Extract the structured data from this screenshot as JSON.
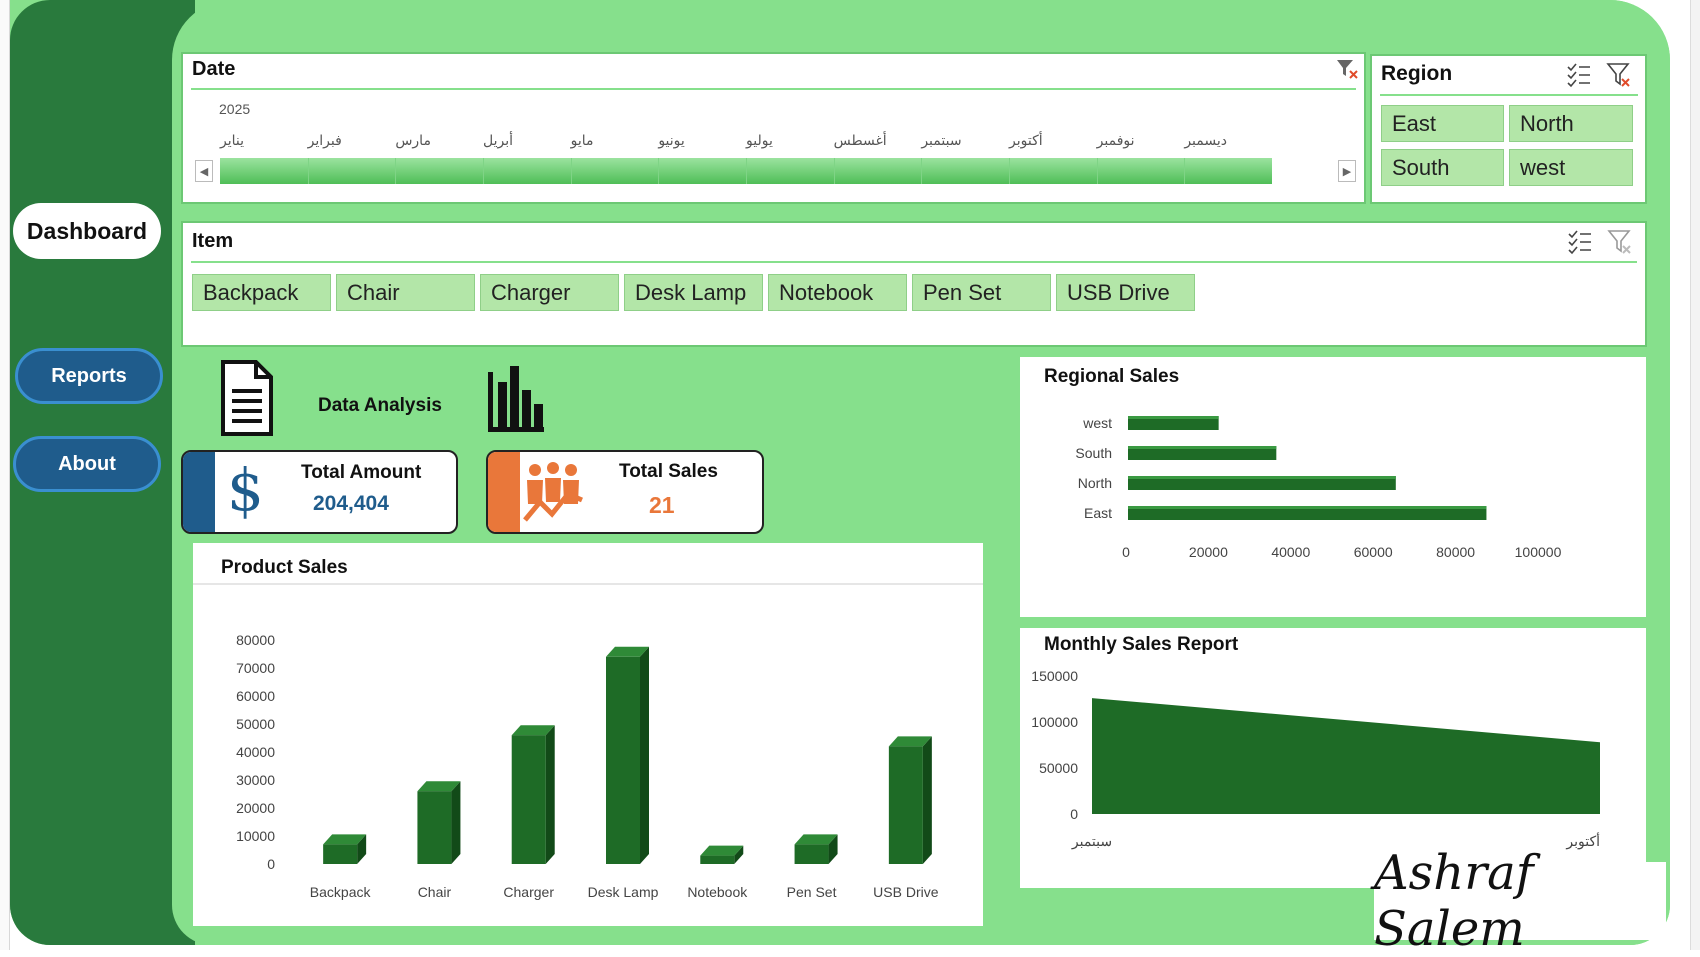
{
  "sidebar": {
    "dashboard_label": "Dashboard",
    "reports_label": "Reports",
    "about_label": "About"
  },
  "date_slicer": {
    "title": "Date",
    "year": "2025",
    "months": [
      "يناير",
      "فبراير",
      "مارس",
      "أبريل",
      "مايو",
      "يونيو",
      "يوليو",
      "أغسطس",
      "سبتمبر",
      "أكتوبر",
      "نوفمبر",
      "ديسمبر"
    ]
  },
  "region_slicer": {
    "title": "Region",
    "items": [
      "East",
      "North",
      "South",
      "west"
    ]
  },
  "item_slicer": {
    "title": "Item",
    "items": [
      "Backpack",
      "Chair",
      "Charger",
      "Desk Lamp",
      "Notebook",
      "Pen Set",
      "USB Drive"
    ]
  },
  "data_analysis_label": "Data Analysis",
  "kpis": {
    "total_amount_label": "Total Amount",
    "total_amount_value": "204,404",
    "total_sales_label": "Total Sales",
    "total_sales_value": "21",
    "dollar_symbol": "$"
  },
  "colors": {
    "bar_green": "#1e6b26",
    "accent_blue": "#1f5c8c",
    "accent_orange": "#e9773a",
    "slicer_fill": "#b3e6a8",
    "panel_green": "#86e08c",
    "sidebar_green": "#297a3d"
  },
  "icons": [
    "document-icon",
    "bar-chart-icon",
    "dollar-icon",
    "people-growth-icon",
    "multi-select-icon",
    "clear-filter-icon",
    "left-arrow-icon",
    "right-arrow-icon"
  ],
  "signature": "Ashraf Salem",
  "chart_data": [
    {
      "type": "bar",
      "title": "Product Sales",
      "categories": [
        "Backpack",
        "Chair",
        "Charger",
        "Desk Lamp",
        "Notebook",
        "Pen Set",
        "USB Drive"
      ],
      "values": [
        7000,
        26000,
        46000,
        74000,
        3000,
        7000,
        42000
      ],
      "ylim": [
        0,
        80000
      ],
      "yticks": [
        "80000",
        "70000",
        "60000",
        "50000",
        "40000",
        "30000",
        "20000",
        "10000",
        "0"
      ],
      "grid": false
    },
    {
      "type": "bar",
      "orientation": "horizontal",
      "title": "Regional Sales",
      "categories": [
        "west",
        "South",
        "North",
        "East"
      ],
      "values": [
        22000,
        36000,
        65000,
        87000
      ],
      "xlim": [
        0,
        100000
      ],
      "xticks": [
        "0",
        "20000",
        "40000",
        "60000",
        "80000",
        "100000"
      ],
      "grid": false
    },
    {
      "type": "area",
      "title": "Monthly Sales Report",
      "categories": [
        "سبتمبر",
        "أكتوبر"
      ],
      "values": [
        126000,
        78000
      ],
      "ylim": [
        0,
        150000
      ],
      "yticks": [
        "150000",
        "100000",
        "50000",
        "0"
      ],
      "grid": false
    }
  ]
}
